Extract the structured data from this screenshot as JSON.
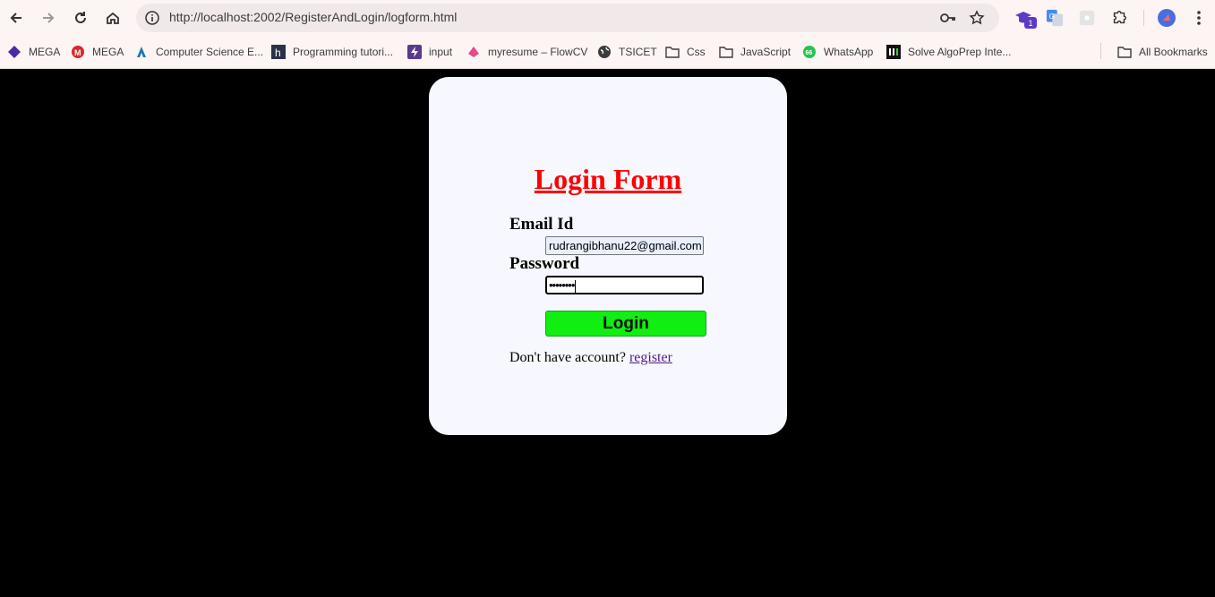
{
  "browser": {
    "url": "http://localhost:2002/RegisterAndLogin/logform.html",
    "extension_badge": "1"
  },
  "bookmarks": [
    {
      "label": "MEGA",
      "icon": "mega-diamond-icon"
    },
    {
      "label": "MEGA",
      "icon": "mega-red-icon"
    },
    {
      "label": "Computer Science E...",
      "icon": "cs-icon"
    },
    {
      "label": "Programming tutori...",
      "icon": "hashnode-icon"
    },
    {
      "label": "input",
      "icon": "bolt-icon"
    },
    {
      "label": "myresume – FlowCV",
      "icon": "flowcv-icon"
    },
    {
      "label": "TSICET",
      "icon": "globe-icon"
    },
    {
      "label": "Css",
      "icon": "folder-icon"
    },
    {
      "label": "JavaScript",
      "icon": "folder-icon"
    },
    {
      "label": "WhatsApp",
      "icon": "whatsapp-icon"
    },
    {
      "label": "Solve AlgoPrep Inte...",
      "icon": "algoprep-icon"
    }
  ],
  "all_bookmarks_label": "All Bookmarks",
  "form": {
    "title": "Login Form",
    "email_label": "Email Id",
    "email_value": "rudrangibhanu22@gmail.com",
    "password_label": "Password",
    "password_value": "••••••••",
    "login_label": "Login",
    "prompt_text": "Don't have account? ",
    "register_link": "register"
  },
  "colors": {
    "title": "#ff0000",
    "login_button": "#11ee11",
    "card": "#f7f8ff",
    "page_background": "#000000"
  }
}
